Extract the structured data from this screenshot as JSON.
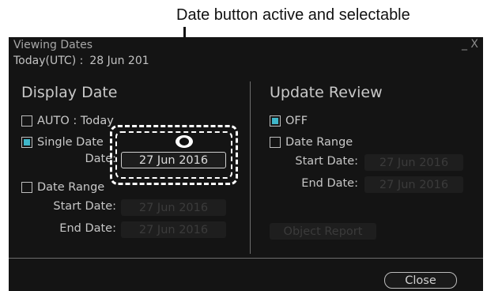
{
  "callout": {
    "text": "Date button active and selectable"
  },
  "dialog": {
    "title": "Viewing Dates",
    "close_glyph": "_ X",
    "today_label": "Today(UTC) :",
    "today_value": "28 Jun 201"
  },
  "display_date": {
    "heading": "Display Date",
    "auto_label": "AUTO : Today",
    "single_label": "Single Date",
    "date_label": "Date:",
    "date_value": "27 Jun 2016",
    "range_label": "Date Range",
    "start_label": "Start Date:",
    "start_value": "27 Jun 2016",
    "end_label": "End  Date:",
    "end_value": "27 Jun 2016"
  },
  "update_review": {
    "heading": "Update Review",
    "off_label": "OFF",
    "range_label": "Date Range",
    "start_label": "Start Date:",
    "start_value": "27 Jun 2016",
    "end_label": "End  Date:",
    "end_value": "27 Jun 2016",
    "object_report": "Object Report"
  },
  "footer": {
    "close_label": "Close"
  },
  "colors": {
    "dialog_bg": "#141414",
    "accent": "#3fb6c9",
    "text": "#c9c9c9",
    "disabled_text": "#3b3b3b"
  }
}
